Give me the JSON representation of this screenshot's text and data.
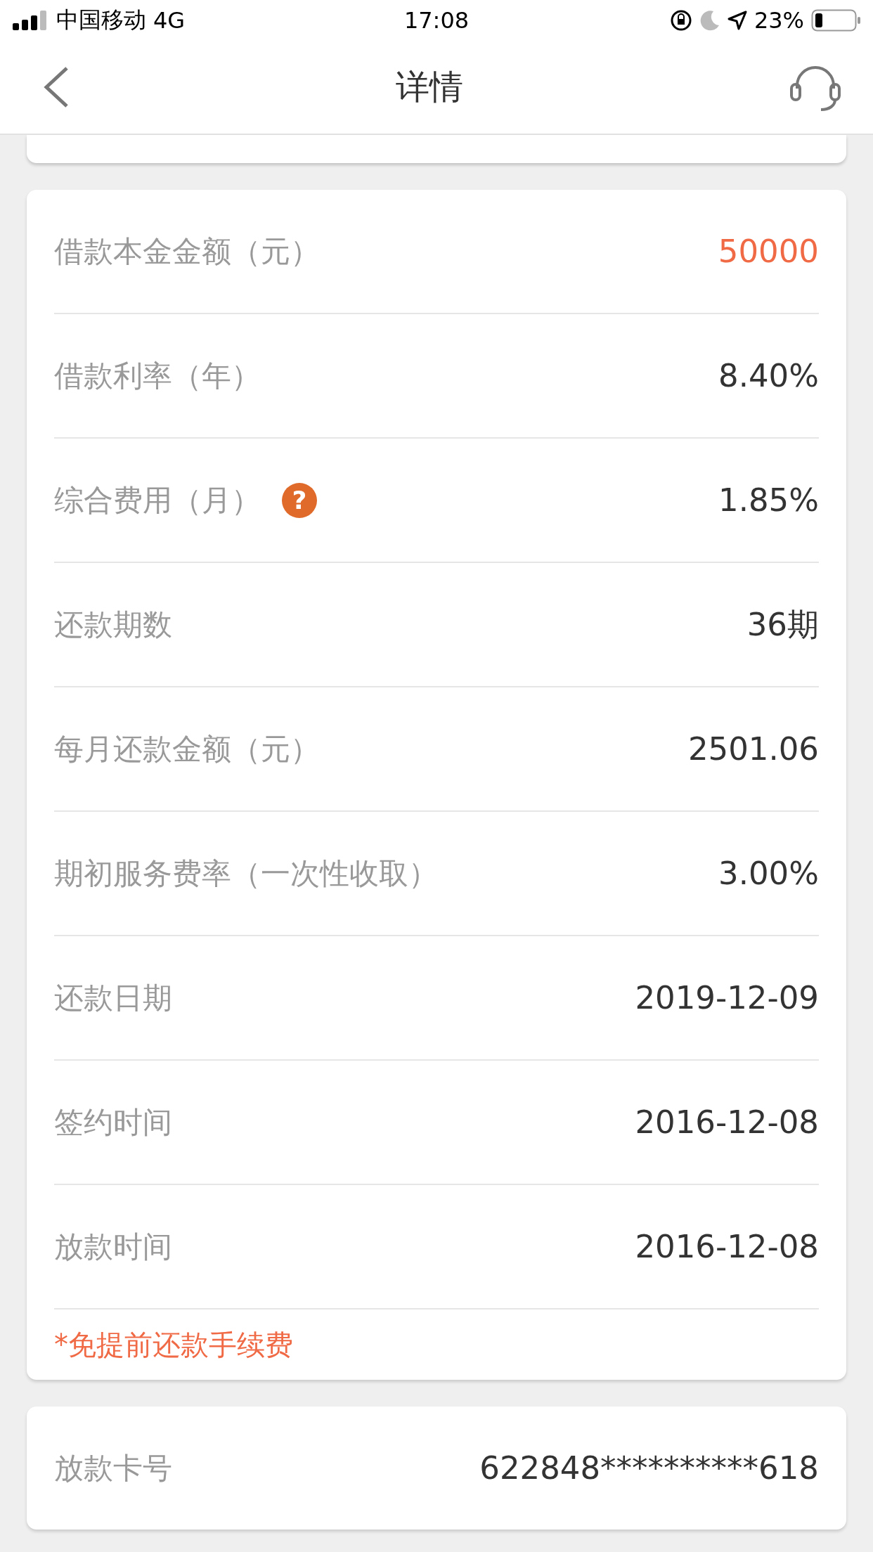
{
  "status_bar": {
    "carrier": "中国移动",
    "network": "4G",
    "time": "17:08",
    "battery": "23%"
  },
  "nav": {
    "title": "详情"
  },
  "details": {
    "rows": [
      {
        "label": "借款本金金额（元）",
        "value": "50000",
        "highlight": true
      },
      {
        "label": "借款利率（年）",
        "value": "8.40%",
        "highlight": false
      },
      {
        "label": "综合费用（月）",
        "help": "?",
        "value": "1.85%",
        "highlight": false
      },
      {
        "label": "还款期数",
        "value": "36期",
        "highlight": false
      },
      {
        "label": "每月还款金额（元）",
        "value": "2501.06",
        "highlight": false
      },
      {
        "label": "期初服务费率（一次性收取）",
        "value": "3.00%",
        "highlight": false
      },
      {
        "label": "还款日期",
        "value": "2019-12-09",
        "highlight": false
      },
      {
        "label": "签约时间",
        "value": "2016-12-08",
        "highlight": false
      },
      {
        "label": "放款时间",
        "value": "2016-12-08",
        "highlight": false
      }
    ],
    "note": "*免提前还款手续费"
  },
  "card": {
    "label": "放款卡号",
    "value": "622848**********618"
  }
}
